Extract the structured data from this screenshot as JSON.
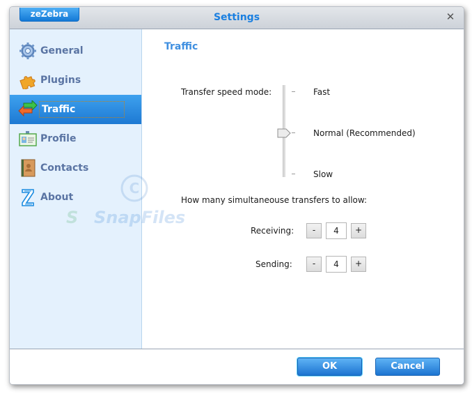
{
  "window": {
    "brand": "zeZebra",
    "title": "Settings",
    "close_icon": "close-icon"
  },
  "sidebar": {
    "items": [
      {
        "id": "general",
        "label": "General",
        "icon": "gear-icon",
        "active": false
      },
      {
        "id": "plugins",
        "label": "Plugins",
        "icon": "puzzle-icon",
        "active": false
      },
      {
        "id": "traffic",
        "label": "Traffic",
        "icon": "transfer-arrows-icon",
        "active": true
      },
      {
        "id": "profile",
        "label": "Profile",
        "icon": "id-card-icon",
        "active": false
      },
      {
        "id": "contacts",
        "label": "Contacts",
        "icon": "address-book-icon",
        "active": false
      },
      {
        "id": "about",
        "label": "About",
        "icon": "zebra-z-icon",
        "active": false
      }
    ]
  },
  "traffic": {
    "section_title": "Traffic",
    "speed_mode_label": "Transfer speed mode:",
    "speed_options": [
      "Fast",
      "Normal (Recommended)",
      "Slow"
    ],
    "speed_selected": "Normal (Recommended)",
    "simultaneous_label": "How many simultaneouse transfers to allow:",
    "receiving": {
      "label": "Receiving:",
      "value": "4",
      "minus": "-",
      "plus": "+"
    },
    "sending": {
      "label": "Sending:",
      "value": "4",
      "minus": "-",
      "plus": "+"
    }
  },
  "footer": {
    "ok_label": "OK",
    "cancel_label": "Cancel"
  },
  "watermark": {
    "text": "SnapFiles"
  }
}
